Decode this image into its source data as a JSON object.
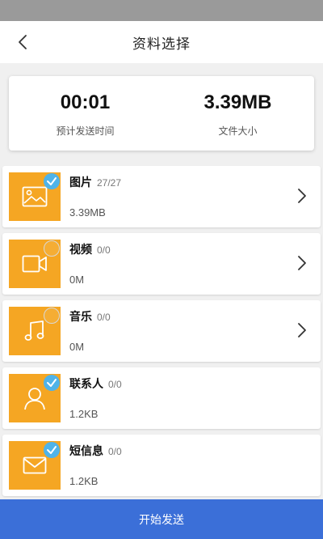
{
  "header": {
    "title": "资料选择",
    "back_icon": "chevron-left-icon"
  },
  "summary": {
    "time_value": "00:01",
    "time_label": "预计发送时间",
    "size_value": "3.39MB",
    "size_label": "文件大小"
  },
  "categories": [
    {
      "name": "图片",
      "count": "27/27",
      "size": "3.39MB",
      "icon": "image-icon",
      "checked": true,
      "has_arrow": true
    },
    {
      "name": "视频",
      "count": "0/0",
      "size": "0M",
      "icon": "video-icon",
      "checked": false,
      "has_arrow": true
    },
    {
      "name": "音乐",
      "count": "0/0",
      "size": "0M",
      "icon": "music-icon",
      "checked": false,
      "has_arrow": true
    },
    {
      "name": "联系人",
      "count": "0/0",
      "size": "1.2KB",
      "icon": "contact-icon",
      "checked": true,
      "has_arrow": false
    },
    {
      "name": "短信息",
      "count": "0/0",
      "size": "1.2KB",
      "icon": "message-icon",
      "checked": true,
      "has_arrow": false
    }
  ],
  "footer": {
    "send_label": "开始发送"
  },
  "colors": {
    "thumb": "#f5a623",
    "check": "#4fb3e8",
    "send_button": "#3b6fd8"
  }
}
